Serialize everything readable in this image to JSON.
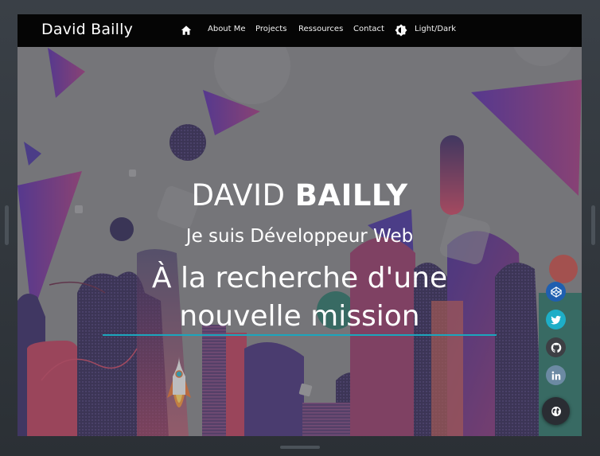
{
  "brand": "David Bailly",
  "nav": {
    "home_icon": "home-icon",
    "links": [
      "About Me",
      "Projects",
      "Ressources",
      "Contact"
    ],
    "theme_icon": "brightness-icon",
    "theme_label": "Light/Dark"
  },
  "hero": {
    "first_name": "DAVID",
    "last_name": "BAILLY",
    "subtitle": "Je suis Développeur Web",
    "mission_line1": "À la recherche d'une",
    "mission_line2": "nouvelle mission"
  },
  "social": [
    {
      "icon": "codepen-icon",
      "color": "#1f5fb0"
    },
    {
      "icon": "twitter-icon",
      "color": "#1eaec7"
    },
    {
      "icon": "github-icon",
      "color": "#3d3f44"
    },
    {
      "icon": "linkedin-icon",
      "color": "#6c8aa3"
    }
  ],
  "fab_icon": "globe-icon",
  "colors": {
    "navbar": "#050505",
    "accent_line": "#1ba6bd"
  }
}
